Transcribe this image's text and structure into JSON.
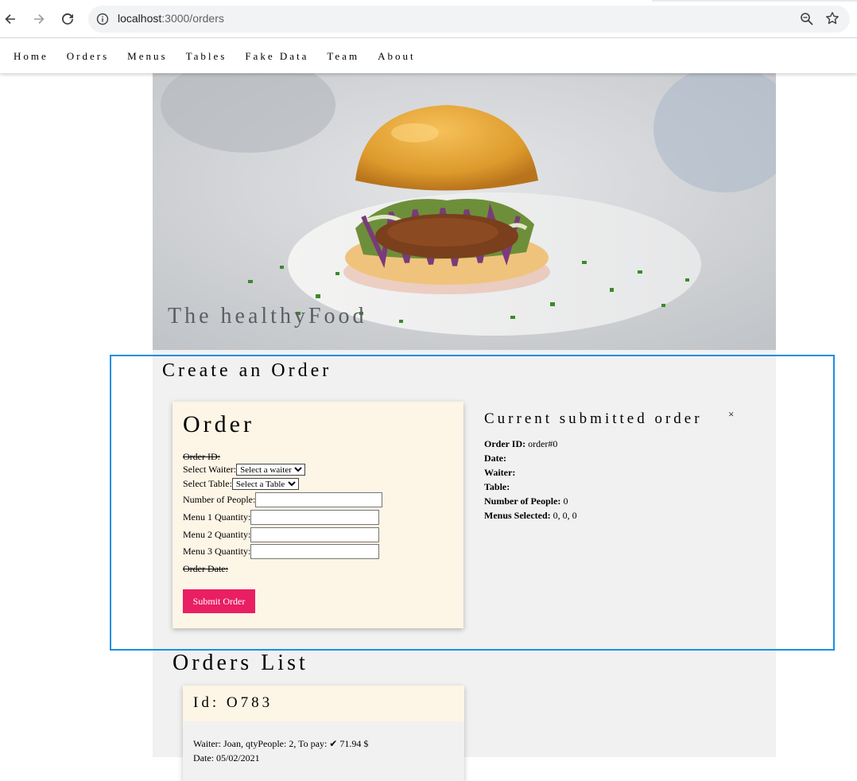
{
  "browser": {
    "url_host": "localhost",
    "url_path": ":3000/orders",
    "icons": [
      "back-arrow-icon",
      "forward-arrow-icon",
      "reload-icon",
      "info-icon",
      "zoom-icon",
      "bookmark-star-icon"
    ]
  },
  "nav": {
    "items": [
      "Home",
      "Orders",
      "Menus",
      "Tables",
      "Fake Data",
      "Team",
      "About"
    ]
  },
  "hero": {
    "title": "The healthyFood"
  },
  "create": {
    "section_title": "Create an Order",
    "card_title": "Order",
    "order_id_label": "Order ID:",
    "waiter_label": "Select Waiter:",
    "waiter_selected": "Select a waiter",
    "table_label": "Select Table:",
    "table_selected": "Select a Table",
    "people_label": "Number of People:",
    "menu1_label": "Menu 1 Quantity:",
    "menu2_label": "Menu 2 Quantity:",
    "menu3_label": "Menu 3 Quantity:",
    "order_date_label": "Order Date:",
    "submit_label": "Submit Order"
  },
  "summary": {
    "title": "Current submitted order",
    "close": "×",
    "order_id_label": "Order ID:",
    "order_id_value": "order#0",
    "date_label": "Date:",
    "waiter_label": "Waiter:",
    "table_label": "Table:",
    "people_label": "Number of People:",
    "people_value": "0",
    "menus_label": "Menus Selected:",
    "menus_value": "0, 0, 0"
  },
  "orders_list": {
    "title": "Orders List",
    "cards": [
      {
        "id_text": "Id: O783",
        "detail": "Waiter: Joan, qtyPeople: 2, To pay: ✔ 71.94 $",
        "date": "Date: 05/02/2021"
      }
    ]
  },
  "colors": {
    "accent": "#e91e63",
    "card_bg": "#fdf5e6",
    "panel_bg": "#f1f1f1",
    "highlight": "#1a8fe3"
  }
}
